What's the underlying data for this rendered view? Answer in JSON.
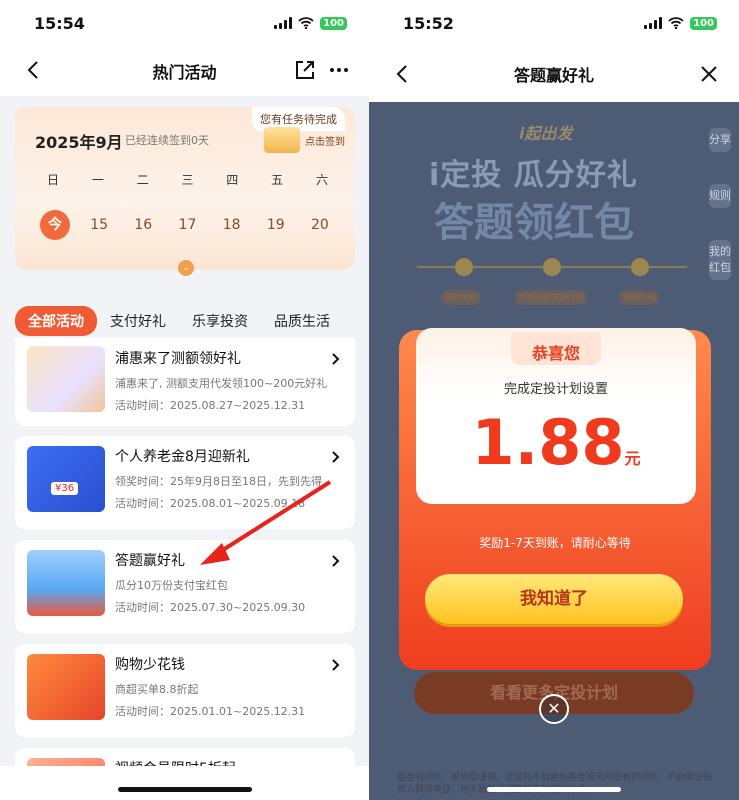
{
  "left": {
    "status": {
      "time": "15:54",
      "battery": "100"
    },
    "nav": {
      "title": "热门活动"
    },
    "calendar": {
      "month": "2025年9月",
      "streak": "已经连续签到0天",
      "task_tag": "您有任务待完成",
      "signin": "点击签到",
      "weekdays": [
        "日",
        "一",
        "二",
        "三",
        "四",
        "五",
        "六"
      ],
      "days": [
        "今",
        "15",
        "16",
        "17",
        "18",
        "19",
        "20"
      ]
    },
    "tabs": [
      "全部活动",
      "支付好礼",
      "乐享投资",
      "品质生活"
    ],
    "cards": [
      {
        "title": "浦惠来了测额领好礼",
        "desc": "浦惠来了, 测额支用代发领100~200元好礼",
        "time": "活动时间：2025.08.27~2025.12.31"
      },
      {
        "title": "个人养老金8月迎新礼",
        "desc": "领奖时间：25年9月8日至18日，先到先得",
        "time": "活动时间：2025.08.01~2025.09.18"
      },
      {
        "title": "答题赢好礼",
        "desc": "瓜分10万份支付宝红包",
        "time": "活动时间：2025.07.30~2025.09.30"
      },
      {
        "title": "购物少花钱",
        "desc": "商超买单8.8折起",
        "time": "活动时间：2025.01.01~2025.12.31"
      },
      {
        "title": "视频会员限时5折起",
        "desc": "",
        "time": ""
      }
    ],
    "thumb_badge": "¥36"
  },
  "right": {
    "status": {
      "time": "15:52",
      "battery": "100"
    },
    "nav": {
      "title": "答题赢好礼"
    },
    "bg": {
      "tag": "i起出发",
      "title1": "i定投 瓜分好礼",
      "title2": "答题领红包",
      "steps": [
        "成功答题",
        "完成设置定投计划",
        "领取红包"
      ]
    },
    "side_tabs": [
      "分享",
      "规则",
      "我的红包"
    ],
    "modal": {
      "congrats": "恭喜您",
      "done": "完成定投计划设置",
      "amount": "1.88",
      "unit": "元",
      "wait": "奖励1-7天到账，请耐心等待",
      "ok": "我知道了"
    },
    "more_plan": "看看更多定投计划",
    "disclaimer": "基金有风险，投资需谨慎。定投并不能避免基金投资所固有的风险，不能保证投资人获得收益，也不是替代储蓄的等效理财方式。"
  },
  "colors": {
    "accent": "#f05a34",
    "gold": "#ffc21f",
    "red": "#ef3a1e"
  }
}
